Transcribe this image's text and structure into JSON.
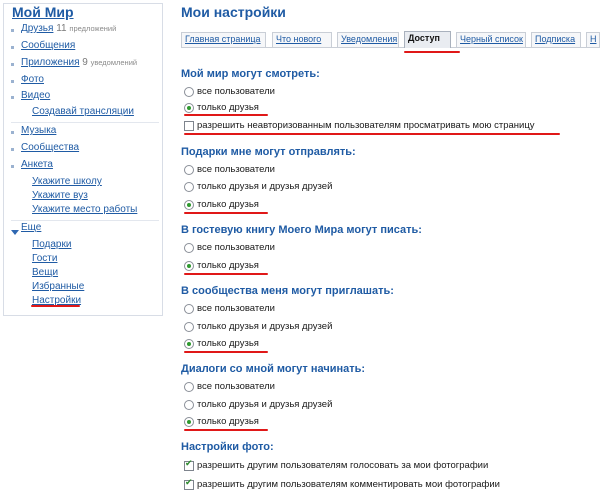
{
  "sidebar": {
    "title": "Мой Мир",
    "items": {
      "friends": {
        "label": "Друзья",
        "count": "11",
        "count_note": "предложений"
      },
      "messages": {
        "label": "Сообщения"
      },
      "apps": {
        "label": "Приложения",
        "count": "9",
        "count_note": "уведомлений"
      },
      "photo": {
        "label": "Фото"
      },
      "video": {
        "label": "Видео"
      },
      "create_broadcast": {
        "label": "Создавай трансляции"
      },
      "music": {
        "label": "Музыка"
      },
      "communities": {
        "label": "Сообщества"
      },
      "questionnaire": {
        "label": "Анкета"
      },
      "school": {
        "label": "Укажите школу"
      },
      "university": {
        "label": "Укажите вуз"
      },
      "workplace": {
        "label": "Укажите место работы"
      },
      "more": {
        "label": "Еще"
      },
      "gifts": {
        "label": "Подарки"
      },
      "guests": {
        "label": "Гости"
      },
      "things": {
        "label": "Вещи"
      },
      "favorites": {
        "label": "Избранные"
      },
      "settings": {
        "label": "Настройки"
      }
    }
  },
  "main": {
    "title": "Мои настройки",
    "tabs": [
      {
        "label": "Главная страница",
        "active": false
      },
      {
        "label": "Что нового",
        "active": false
      },
      {
        "label": "Уведомления",
        "active": false
      },
      {
        "label": "Доступ",
        "active": true
      },
      {
        "label": "Черный список",
        "active": false
      },
      {
        "label": "Подписка",
        "active": false
      },
      {
        "label": "Н",
        "active": false
      }
    ],
    "sections": {
      "view": {
        "heading": "Мой мир могут смотреть:",
        "options": [
          "все пользователи",
          "только друзья"
        ],
        "selected": "только друзья",
        "checkbox_label": "разрешить неавторизованным пользователям просматривать мою страницу",
        "checkbox_checked": false
      },
      "gifts": {
        "heading": "Подарки мне могут отправлять:",
        "options": [
          "все пользователи",
          "только друзья и друзья друзей",
          "только друзья"
        ],
        "selected": "только друзья"
      },
      "guestbook": {
        "heading": "В гостевую книгу Моего Мира могут писать:",
        "options": [
          "все пользователи",
          "только друзья"
        ],
        "selected": "только друзья"
      },
      "communities": {
        "heading": "В сообщества меня могут приглашать:",
        "options": [
          "все пользователи",
          "только друзья и друзья друзей",
          "только друзья"
        ],
        "selected": "только друзья"
      },
      "dialogs": {
        "heading": "Диалоги со мной могут начинать:",
        "options": [
          "все пользователи",
          "только друзья и друзья друзей",
          "только друзья"
        ],
        "selected": "только друзья"
      },
      "photo": {
        "heading": "Настройки фото:",
        "checks": [
          {
            "label": "разрешить другим пользователям голосовать за мои фотографии",
            "checked": true
          },
          {
            "label": "разрешить другим пользователям комментировать мои фотографии",
            "checked": true
          }
        ]
      }
    }
  },
  "colors": {
    "link": "#1f5ba4",
    "highlight": "#e01818",
    "radio_dot": "#2f9a2f"
  }
}
